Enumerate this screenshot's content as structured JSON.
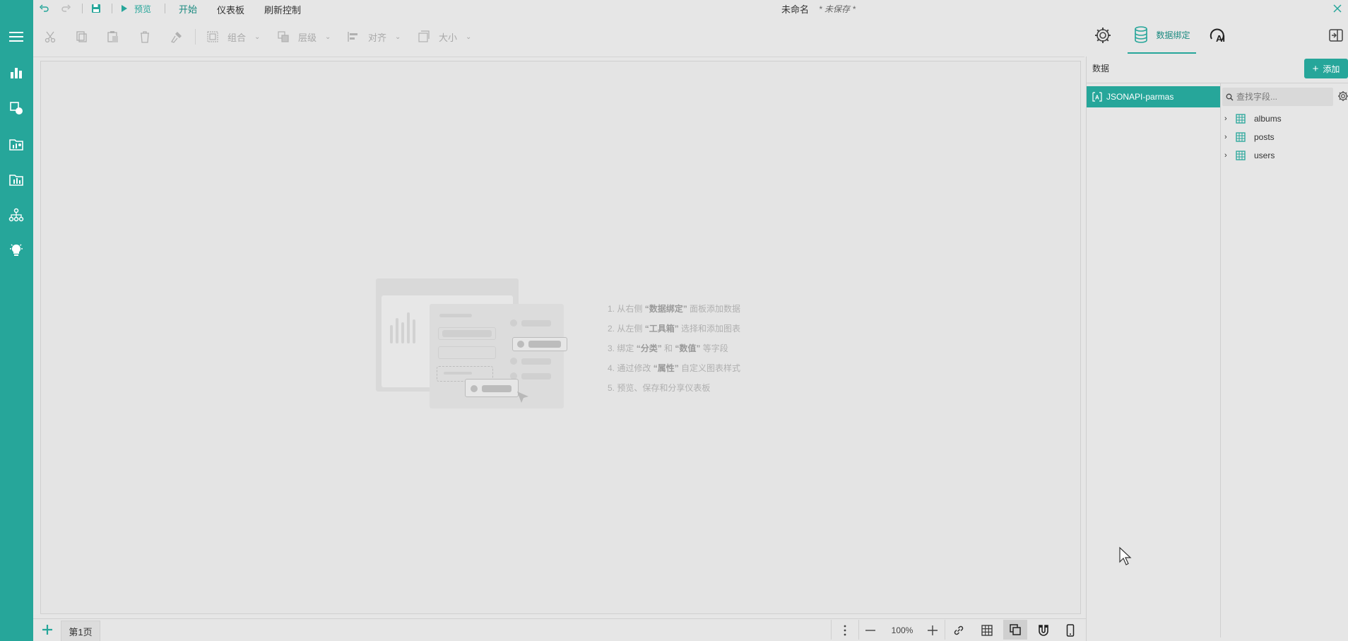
{
  "titlebar": {
    "preview_label": "预览",
    "tabs": [
      "开始",
      "仪表板",
      "刷新控制"
    ],
    "doc_title": "未命名",
    "save_status": "* 未保存 *"
  },
  "toolbar": {
    "group_label": "组合",
    "layer_label": "层级",
    "align_label": "对齐",
    "size_label": "大小"
  },
  "right_tabs": {
    "data_binding_label": "数据绑定"
  },
  "data_panel": {
    "title": "数据",
    "add_label": "添加",
    "datasource": "JSONAPI-parmas",
    "search_placeholder": "查找字段...",
    "tables": [
      "albums",
      "posts",
      "users"
    ]
  },
  "empty_state": {
    "hints": [
      {
        "pre": "1. 从右侧 ",
        "bold": "“数据绑定”",
        "post": " 面板添加数据"
      },
      {
        "pre": "2. 从左侧 ",
        "bold": "“工具箱”",
        "post": " 选择和添加图表"
      },
      {
        "pre": "3. 绑定 ",
        "bold": "“分类”",
        "mid": " 和 ",
        "bold2": "“数值”",
        "post": " 等字段"
      },
      {
        "pre": "4. 通过修改 ",
        "bold": "“属性”",
        "post": " 自定义图表样式"
      },
      {
        "pre": "5. 预览、保存和分享仪表板",
        "bold": "",
        "post": ""
      }
    ]
  },
  "bottom_bar": {
    "page_tab": "第1页",
    "zoom": "100%"
  },
  "colors": {
    "accent": "#26a69a",
    "accent_dark": "#1b8a80"
  }
}
